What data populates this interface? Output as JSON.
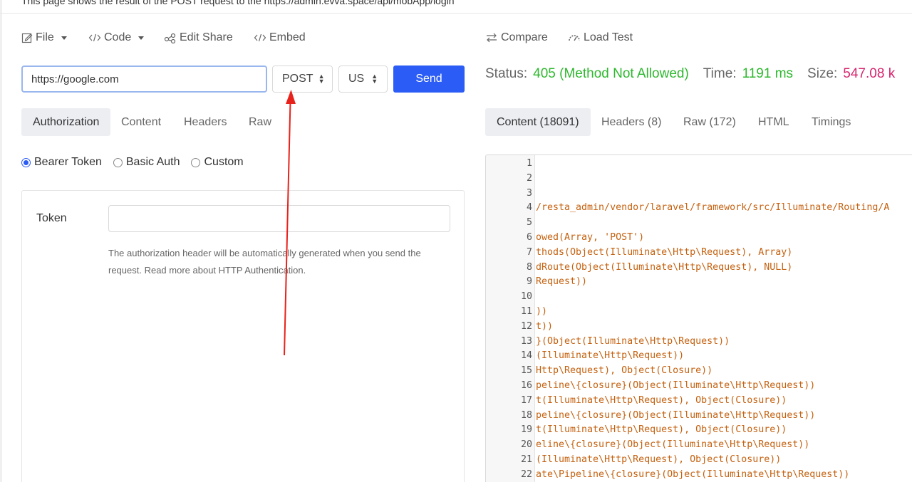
{
  "page_note": "This page shows the result of the POST request to the https://admin.evva.space/api/mobApp/login",
  "toolbar": {
    "file": "File",
    "code": "Code",
    "edit_share": "Edit Share",
    "embed": "Embed",
    "compare": "Compare",
    "load_test": "Load Test"
  },
  "request": {
    "url": "https://google.com",
    "method": "POST",
    "region": "US",
    "send_label": "Send"
  },
  "request_tabs": [
    "Authorization",
    "Content",
    "Headers",
    "Raw"
  ],
  "auth": {
    "options": [
      "Bearer Token",
      "Basic Auth",
      "Custom"
    ],
    "selected": "Bearer Token",
    "token_label": "Token",
    "token_value": "",
    "help_line1": "The authorization header will be automatically generated when you send the",
    "help_line2": "request. Read more about HTTP Authentication."
  },
  "response": {
    "status_label": "Status:",
    "status_value": "405 (Method Not Allowed)",
    "time_label": "Time:",
    "time_value": "1191 ms",
    "size_label": "Size:",
    "size_value": "547.08 k"
  },
  "response_tabs": [
    "Content (18091)",
    "Headers (8)",
    "Raw (172)",
    "HTML",
    "Timings"
  ],
  "code_lines": [
    {
      "n": "1",
      "text": ""
    },
    {
      "n": "2",
      "text": ""
    },
    {
      "n": "3",
      "text": ""
    },
    {
      "n": "4",
      "text": "/resta_admin/vendor/laravel/framework/src/Illuminate/Routing/A"
    },
    {
      "n": "5",
      "text": ""
    },
    {
      "n": "6",
      "text": "owed(Array, 'POST')"
    },
    {
      "n": "7",
      "text": "thods(Object(Illuminate\\Http\\Request), Array)"
    },
    {
      "n": "8",
      "text": "dRoute(Object(Illuminate\\Http\\Request), NULL)"
    },
    {
      "n": "9",
      "text": "Request))"
    },
    {
      "n": "10",
      "text": ""
    },
    {
      "n": "11",
      "text": "))"
    },
    {
      "n": "12",
      "text": "t))"
    },
    {
      "n": "13",
      "text": "}(Object(Illuminate\\Http\\Request))"
    },
    {
      "n": "14",
      "text": "(Illuminate\\Http\\Request))"
    },
    {
      "n": "15",
      "text": "Http\\Request), Object(Closure))"
    },
    {
      "n": "16",
      "text": "peline\\{closure}(Object(Illuminate\\Http\\Request))"
    },
    {
      "n": "17",
      "text": "t(Illuminate\\Http\\Request), Object(Closure))"
    },
    {
      "n": "18",
      "text": "peline\\{closure}(Object(Illuminate\\Http\\Request))"
    },
    {
      "n": "19",
      "text": "t(Illuminate\\Http\\Request), Object(Closure))"
    },
    {
      "n": "20",
      "text": "eline\\{closure}(Object(Illuminate\\Http\\Request))"
    },
    {
      "n": "21",
      "text": "(Illuminate\\Http\\Request), Object(Closure))"
    },
    {
      "n": "22",
      "text": "ate\\Pipeline\\{closure}(Object(Illuminate\\Http\\Request))"
    }
  ],
  "colors": {
    "accent": "#2b5cf5",
    "status_green": "#2eb82e",
    "size_pink": "#d6246e",
    "code_orange": "#c5610f",
    "annotation_arrow": "#e8221b"
  }
}
